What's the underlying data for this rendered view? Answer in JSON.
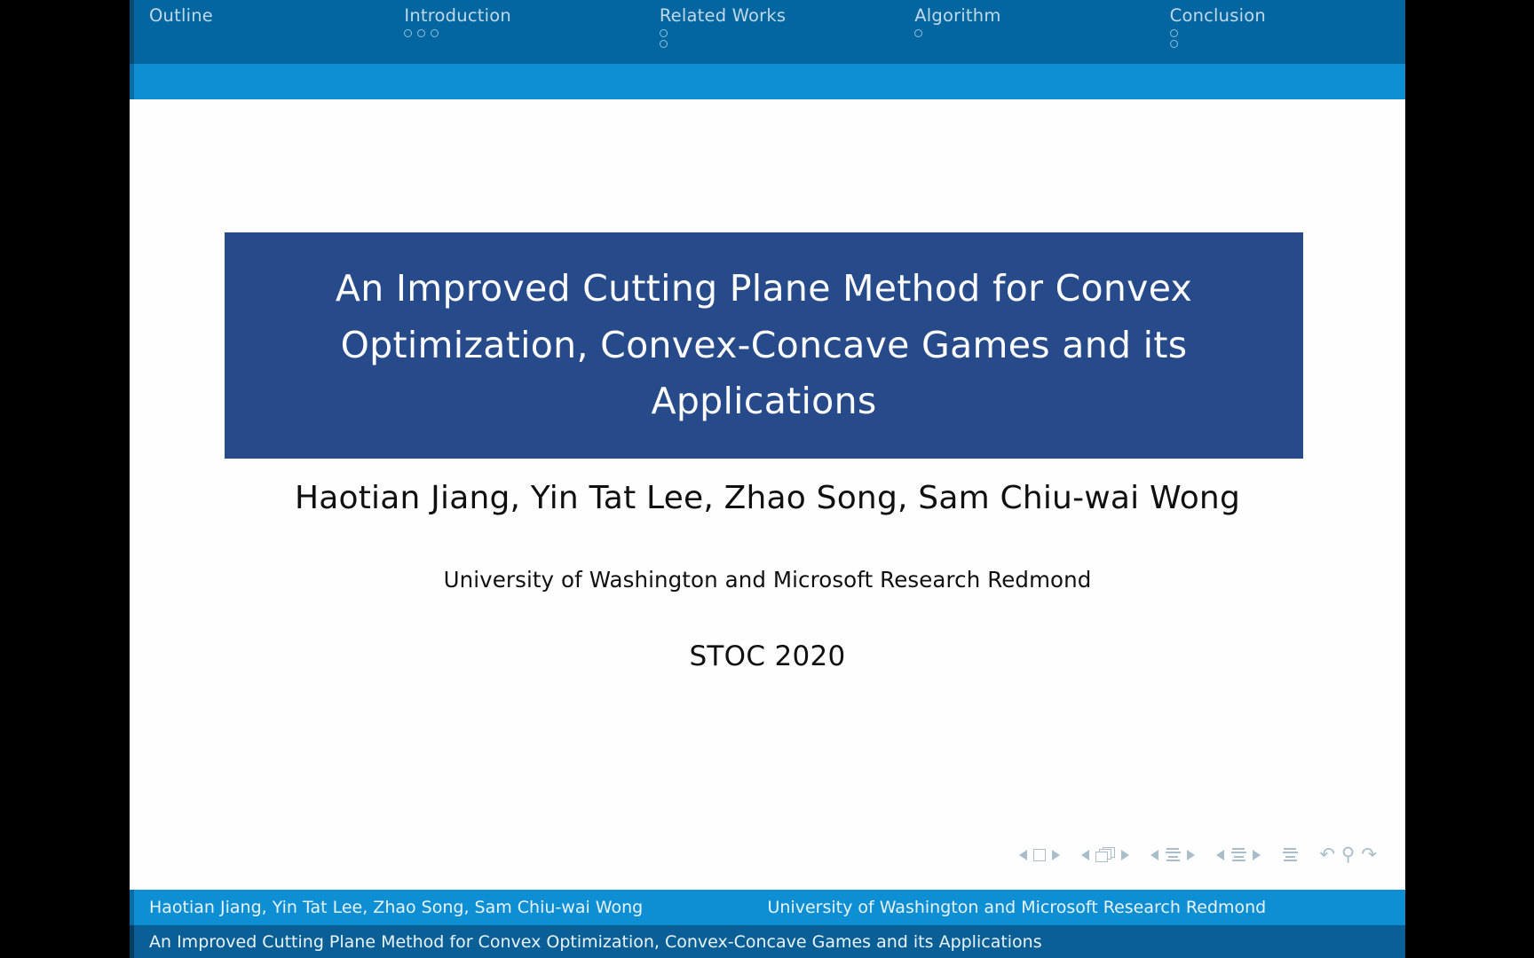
{
  "navbar": {
    "sections": [
      {
        "label": "Outline",
        "dot_rows": []
      },
      {
        "label": "Introduction",
        "dot_rows": [
          3
        ]
      },
      {
        "label": "Related Works",
        "dot_rows": [
          1,
          1
        ]
      },
      {
        "label": "Algorithm",
        "dot_rows": [
          1
        ]
      },
      {
        "label": "Conclusion",
        "dot_rows": [
          1,
          1
        ]
      }
    ]
  },
  "slide": {
    "title": "An Improved Cutting Plane Method for Convex Optimization, Convex-Concave Games and its Applications",
    "authors": "Haotian Jiang, Yin Tat Lee, Zhao Song, Sam Chiu-wai Wong",
    "affiliation": "University of Washington and Microsoft Research Redmond",
    "venue": "STOC 2020"
  },
  "footer": {
    "authors_short": "Haotian Jiang, Yin Tat Lee, Zhao Song, Sam Chiu-wai Wong",
    "affiliation_short": "University of Washington and Microsoft Research Redmond",
    "title_short": "An Improved Cutting Plane Method for Convex Optimization, Convex-Concave Games and its Applications"
  },
  "nav_symbols": {
    "groups": [
      {
        "icon": "frame-icon",
        "prev": "◂",
        "next": "▸"
      },
      {
        "icon": "slides-icon",
        "prev": "◂",
        "next": "▸"
      },
      {
        "icon": "subsection-icon",
        "prev": "◂",
        "next": "▸"
      },
      {
        "icon": "section-icon",
        "prev": "◂",
        "next": "▸"
      }
    ],
    "doc_icon": "document-icon",
    "back_icon": "↶",
    "search_icon": "⚲",
    "forward_icon": "↷"
  },
  "colors": {
    "navbar": "#0366a0",
    "subbar": "#0e8fd4",
    "title_block": "#264a8a",
    "footer_top": "#0e8fd4",
    "footer_bottom": "#0a6096",
    "slide_bg": "#fefefe",
    "letterbox": "#000000"
  }
}
